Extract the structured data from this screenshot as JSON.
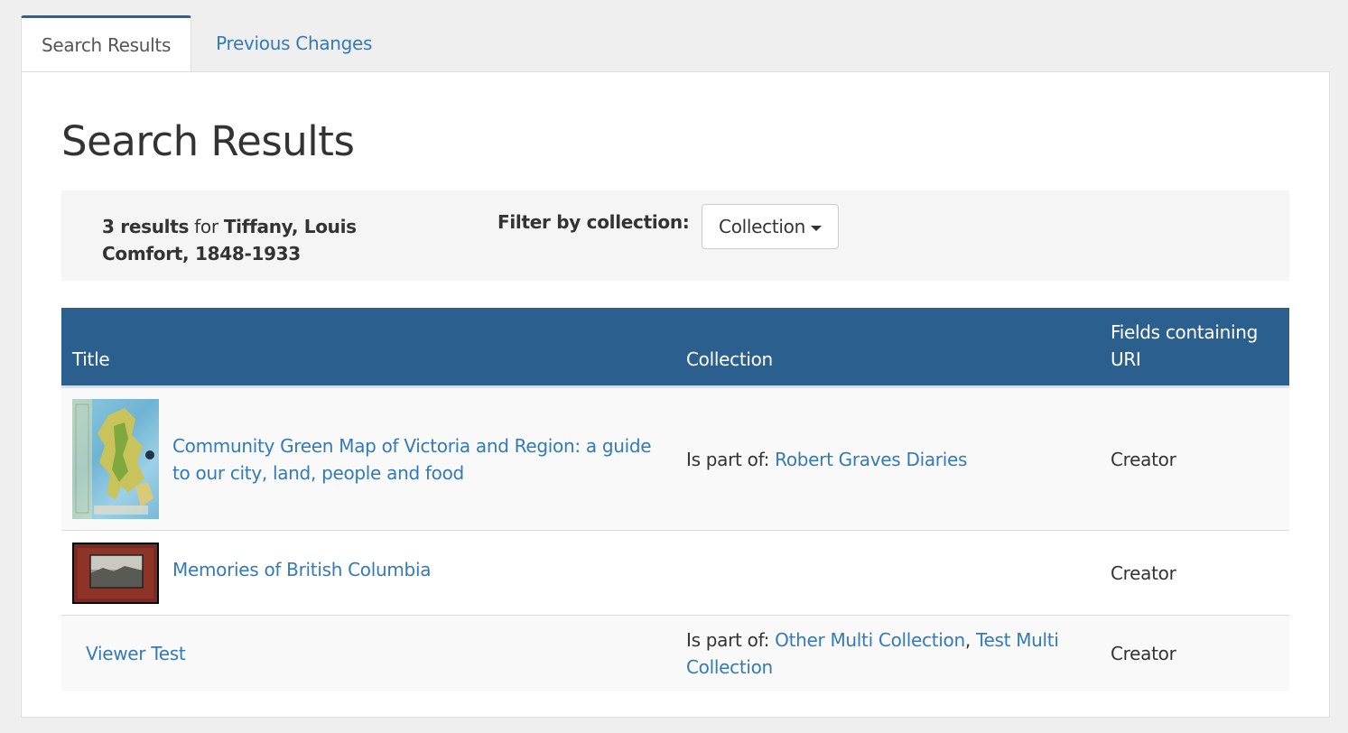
{
  "tabs": [
    {
      "label": "Search Results",
      "active": true
    },
    {
      "label": "Previous Changes",
      "active": false
    }
  ],
  "page_title": "Search Results",
  "summary": {
    "count": "3 results",
    "for_text": "for",
    "query_line1": "Tiffany, Louis",
    "query_line2": "Comfort, 1848-1933",
    "filter_label": "Filter by collection:",
    "filter_button": "Collection"
  },
  "table": {
    "headers": [
      "Title",
      "Collection",
      "Fields containing URI"
    ],
    "rows": [
      {
        "thumbnail": "map-thumbnail",
        "title": "Community Green Map of Victoria and Region: a guide to our city, land, people and food",
        "collection_prefix": "Is part of:",
        "collections": [
          "Robert Graves Diaries"
        ],
        "fields": "Creator"
      },
      {
        "thumbnail": "album-thumbnail",
        "title": "Memories of British Columbia",
        "collection_prefix": "",
        "collections": [],
        "fields": "Creator"
      },
      {
        "thumbnail": "",
        "title": "Viewer Test",
        "collection_prefix": "Is part of:",
        "collections": [
          "Other Multi Collection",
          "Test Multi Collection"
        ],
        "fields": "Creator"
      }
    ]
  },
  "colors": {
    "header_bg": "#2a5f8e",
    "link": "#337ab7",
    "active_tab_border": "#2a6496"
  }
}
